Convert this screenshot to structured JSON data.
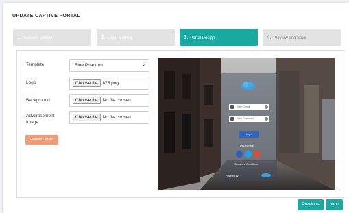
{
  "page": {
    "title": "UPDATE CAPTIVE PORTAL"
  },
  "steps": [
    {
      "num": "1.",
      "label": "Network Details"
    },
    {
      "num": "2.",
      "label": "Login Method"
    },
    {
      "num": "3.",
      "label": "Portal Design"
    },
    {
      "num": "4.",
      "label": "Preview and Save"
    }
  ],
  "form": {
    "template": {
      "label": "Template",
      "value": "Blue Phantom"
    },
    "logo": {
      "label": "Logo",
      "button": "Choose file",
      "file": "875.png"
    },
    "background": {
      "label": "Background",
      "button": "Choose file",
      "file": "No file chosen"
    },
    "advertisement": {
      "label_line1": "Advertisement",
      "label_line2": "Image",
      "button": "Choose file",
      "file": "No file chosen"
    },
    "restore_label": "Restore Default"
  },
  "preview": {
    "email_placeholder": "Enter E-mail",
    "password_placeholder": "Enter Password",
    "login_label": "Login",
    "login_with": "Or Login with",
    "terms": "Terms and Conditions",
    "powered_by": "Powered by"
  },
  "navigation": {
    "previous": "Previous",
    "next": "Next"
  },
  "colors": {
    "accent": "#19a9a0",
    "restore": "#f49a73",
    "login_button": "#2e66c7"
  }
}
